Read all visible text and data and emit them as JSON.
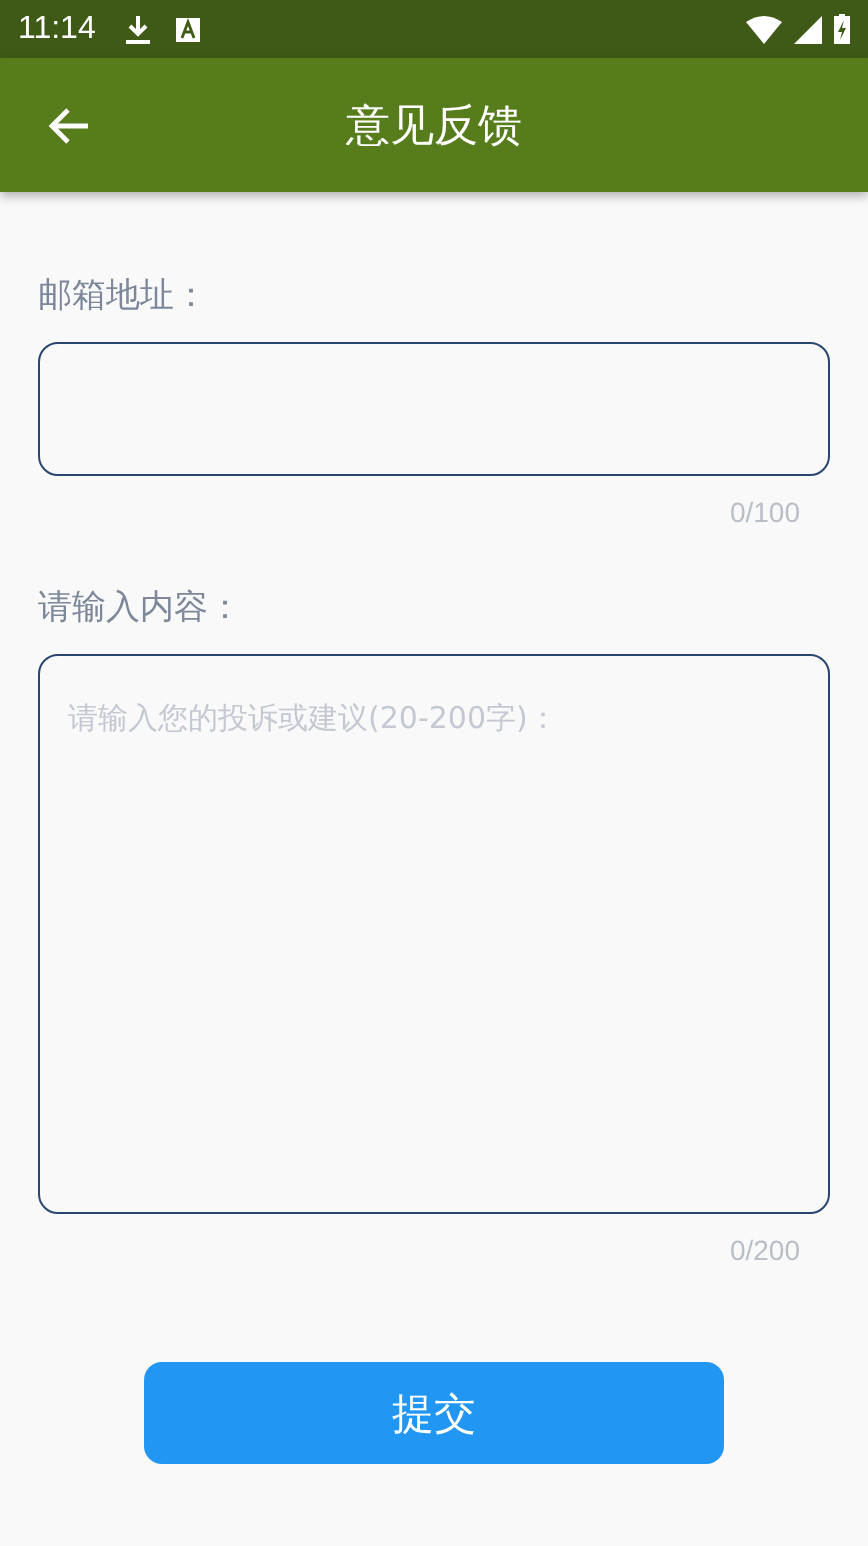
{
  "status_bar": {
    "time": "11:14"
  },
  "app_bar": {
    "title": "意见反馈"
  },
  "fields": [
    {
      "label": "邮箱地址：",
      "kind": "input",
      "counter": "0/100"
    },
    {
      "label": "请输入内容：",
      "kind": "textarea",
      "placeholder": "请输入您的投诉或建议(20-200字)：",
      "counter": "0/200"
    }
  ],
  "submit_button": "提交"
}
